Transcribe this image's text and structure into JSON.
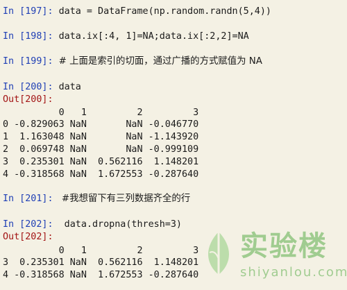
{
  "lines": [
    {
      "kind": "in",
      "num": "197",
      "code": "data = DataFrame(np.random.randn(5,4))"
    },
    {
      "kind": "in",
      "num": "198",
      "code": "data.ix[:4, 1]=NA;data.ix[:2,2]=NA"
    },
    {
      "kind": "in",
      "num": "199",
      "code": "# 上面是索引的切面，通过广播的方式赋值为 NA"
    },
    {
      "kind": "in",
      "num": "200",
      "code": "data"
    },
    {
      "kind": "out",
      "num": "200"
    },
    {
      "kind": "text",
      "text": "          0   1         2         3"
    },
    {
      "kind": "text",
      "text": "0 -0.829063 NaN       NaN -0.046770"
    },
    {
      "kind": "text",
      "text": "1  1.163048 NaN       NaN -1.143920"
    },
    {
      "kind": "text",
      "text": "2  0.069748 NaN       NaN -0.999109"
    },
    {
      "kind": "text",
      "text": "3  0.235301 NaN  0.562116  1.148201"
    },
    {
      "kind": "text",
      "text": "4 -0.318568 NaN  1.672553 -0.287640"
    },
    {
      "kind": "in",
      "num": "201",
      "code": " #我想留下有三列数据齐全的行"
    },
    {
      "kind": "in",
      "num": "202",
      "code": " data.dropna(thresh=3)"
    },
    {
      "kind": "out",
      "num": "202"
    },
    {
      "kind": "text",
      "text": "          0   1         2         3"
    },
    {
      "kind": "text",
      "text": "3  0.235301 NaN  0.562116  1.148201"
    },
    {
      "kind": "text",
      "text": "4 -0.318568 NaN  1.672553 -0.287640"
    }
  ],
  "prompt": {
    "in_label": "In",
    "out_label": "Out",
    "in_color": "#1f3fb5",
    "out_color": "#a31515"
  },
  "watermark": {
    "title": "实验楼",
    "url": "shiyanlou.com",
    "color": "#5cae4c"
  }
}
